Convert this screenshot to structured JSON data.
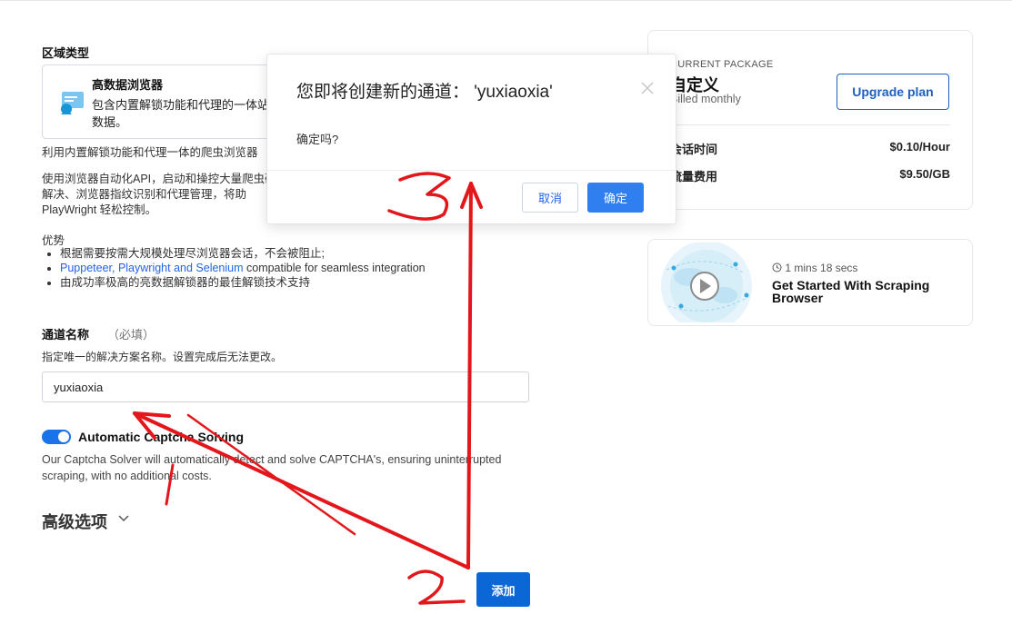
{
  "zone": {
    "section_title": "区域类型",
    "card_name": "高数据浏览器",
    "card_desc": "包含内置解锁功能和代理的一体站，抓取数据。",
    "summary": "利用内置解锁功能和代理一体的爬虫浏览器",
    "detail": "使用浏览器自动化API，启动和操控大量爬虫码解决、浏览器指纹识别和代理管理，将助PlayWright 轻松控制。",
    "advantages_title": "优势",
    "adv1": "根据需要按需大规模处理尽浏览器会话，不会被阻止;",
    "adv2_link": "Puppeteer, Playwright and Selenium",
    "adv2_rest": " compatible for seamless integration",
    "adv3": "由成功率极高的亮数据解锁器的最佳解锁技术支持"
  },
  "form": {
    "name_label": "通道名称",
    "name_required": "（必填）",
    "name_hint": "指定唯一的解决方案名称。设置完成后无法更改。",
    "name_value": "yuxiaoxia",
    "captcha_label": "Automatic Captcha Solving",
    "captcha_enabled": true,
    "captcha_desc": "Our Captcha Solver will automatically detect and solve CAPTCHA's, ensuring uninterrupted scraping, with no additional costs.",
    "advanced_label": "高级选项",
    "add_button": "添加"
  },
  "package": {
    "label": "CURRENT PACKAGE",
    "name": "自定义",
    "billing": "Billed monthly",
    "upgrade_button": "Upgrade plan",
    "rows": [
      {
        "label": "会话时间",
        "value": "$0.10/Hour"
      },
      {
        "label": "流量费用",
        "value": "$9.50/GB"
      }
    ]
  },
  "video": {
    "duration": "1 mins 18 secs",
    "title": "Get Started With Scraping Browser"
  },
  "modal": {
    "title": "您即将创建新的通道：  'yuxiaoxia'",
    "body": "确定吗?",
    "cancel_button": "取消",
    "confirm_button": "确定"
  },
  "annotations": {
    "step1": "1",
    "step2": "2",
    "step3": "3",
    "color": "#e3171b"
  },
  "colors": {
    "primary": "#0b66d6",
    "toggle_on": "#1a73e8",
    "link": "#2563eb"
  }
}
